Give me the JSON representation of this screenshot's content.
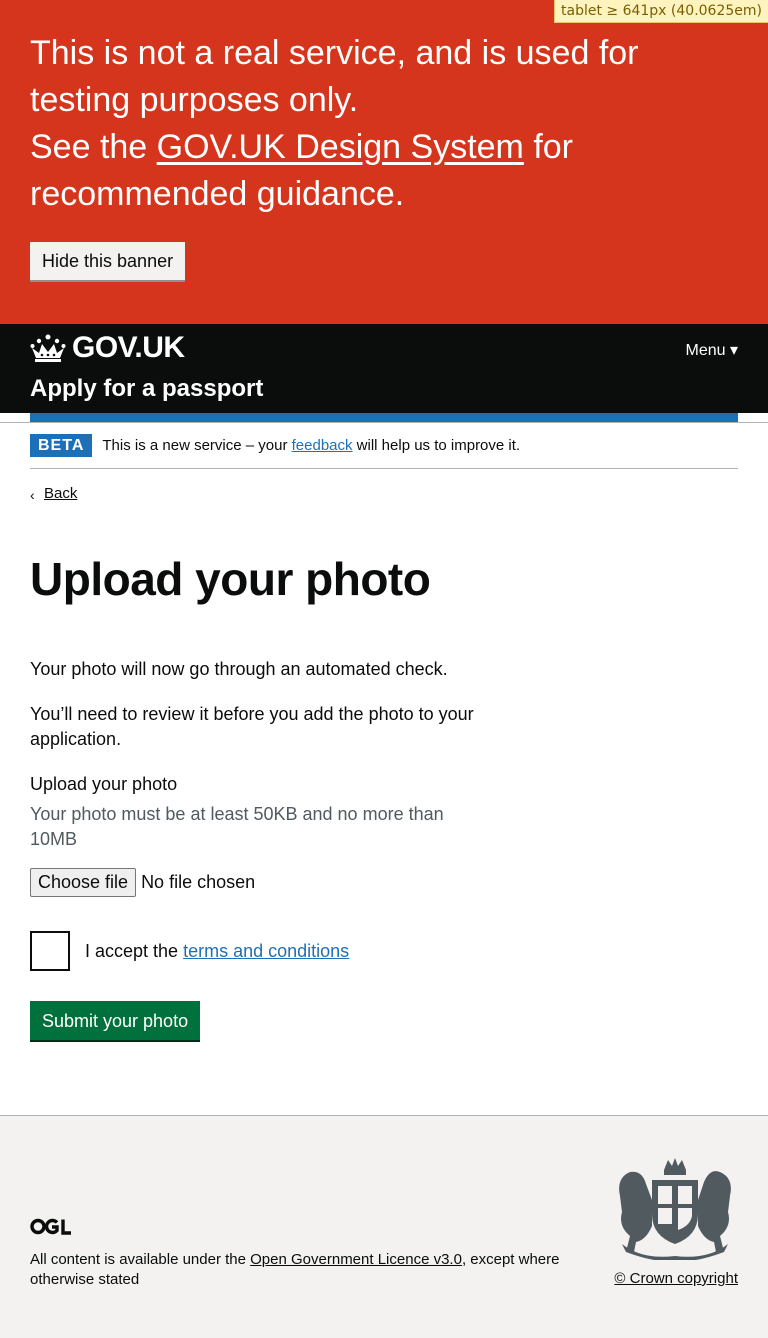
{
  "breakpoint_badge": "tablet ≥ 641px (40.0625em)",
  "warning": {
    "line1": "This is not a real service, and is used for testing purposes only.",
    "see_the": "See the ",
    "link": "GOV.UK Design System",
    "after_link": " for recommended guidance.",
    "hide_button": "Hide this banner"
  },
  "header": {
    "logo": "GOV.UK",
    "service_name": "Apply for a passport",
    "menu": "Menu ▾"
  },
  "phase": {
    "tag": "BETA",
    "text_before": "This is a new service – your ",
    "link": "feedback",
    "text_after": " will help us to improve it."
  },
  "back_link": "Back",
  "page": {
    "title": "Upload your photo",
    "para1": "Your photo will now go through an automated check.",
    "para2": "You’ll need to review it before you add the photo to your application.",
    "upload_label": "Upload your photo",
    "upload_hint": "Your photo must be at least 50KB and no more than 10MB",
    "choose_file": "Choose file",
    "no_file": "No file chosen",
    "accept_before": "I accept the ",
    "accept_link": "terms and conditions",
    "submit": "Submit your photo"
  },
  "footer": {
    "licence_before": "All content is available under the ",
    "licence_link": "Open Government Licence v3.0",
    "licence_after": ", except where otherwise stated",
    "copyright": "© Crown copyright"
  },
  "colors": {
    "warning_red": "#d4351c",
    "header_black": "#0b0c0c",
    "link_blue": "#1d70b8",
    "button_green": "#00703c",
    "footer_grey": "#f3f2f1"
  }
}
